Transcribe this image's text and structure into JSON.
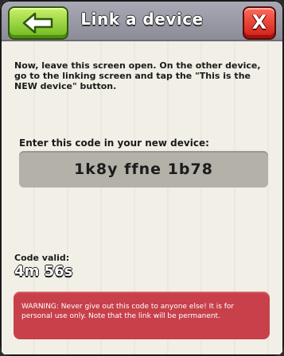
{
  "header": {
    "title": "Link a device",
    "close_label": "X"
  },
  "instructions": "Now, leave this screen open. On the other device, go to the linking screen and tap the \"This is the NEW device\" button.",
  "code": {
    "label": "Enter this code in your new device:",
    "value": "1k8y ffne 1b78"
  },
  "validity": {
    "label": "Code valid:",
    "remaining": "4m 56s"
  },
  "warning": "WARNING: Never give out this code to anyone else! It is for personal use only. Note that the link will be permanent.",
  "colors": {
    "back_button": "#6fb81e",
    "close_button": "#d11d16",
    "warning_background": "#c7404a",
    "code_box": "#b3b1a8"
  },
  "icons": {
    "back": "arrow-left-icon"
  }
}
